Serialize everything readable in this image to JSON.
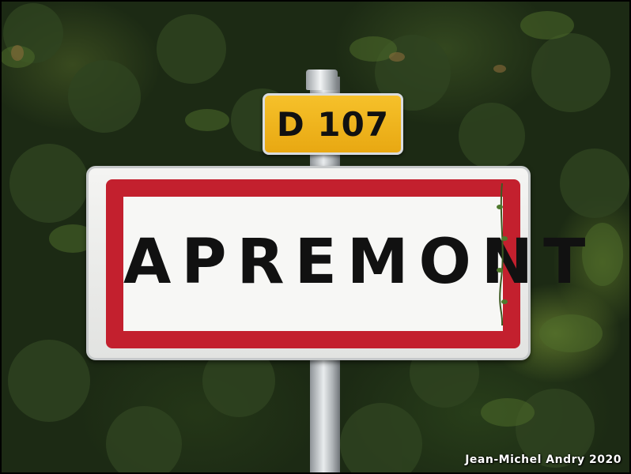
{
  "sign": {
    "route_number": "D 107",
    "town_name": "APREMONT"
  },
  "credit": "Jean-Michel Andry 2020",
  "colors": {
    "route_plate": "#f0b41c",
    "town_border_red": "#c3202e",
    "foliage_dark": "#1c2a14",
    "foliage_light": "#8caa3c"
  }
}
